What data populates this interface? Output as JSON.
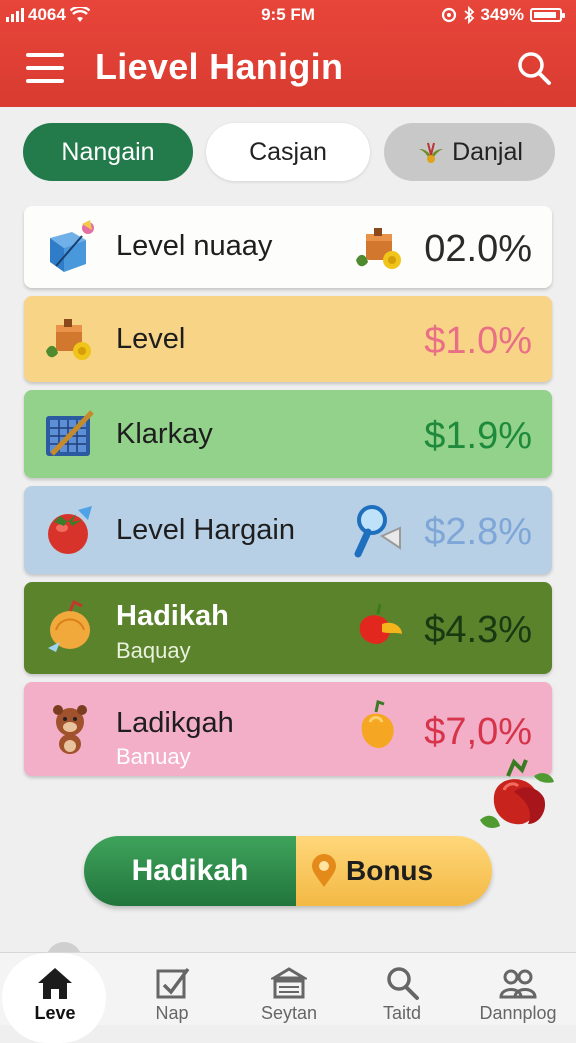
{
  "status_bar": {
    "carrier": "4064",
    "time": "9:5 FM",
    "battery": "349%"
  },
  "header": {
    "title": "Lievel Hanigin"
  },
  "tabs": [
    {
      "label": "Nangain"
    },
    {
      "label": "Casjan"
    },
    {
      "label": "Danjal"
    }
  ],
  "cards": [
    {
      "label": "Level nuaay",
      "value": "02.0%",
      "value_color": "#2a2a2a",
      "icon": "blue-cube-icon",
      "deco": "crate-icon"
    },
    {
      "label": "Level",
      "value": "$1.0%",
      "value_color": "#e96f86",
      "icon": "crate-icon"
    },
    {
      "label": "Klarkay",
      "value": "$1.9%",
      "value_color": "#1f8a3c",
      "icon": "grid-tablet-icon"
    },
    {
      "label": "Level Hargain",
      "value": "$2.8%",
      "value_color": "#7ea7d8",
      "icon": "tomato-icon",
      "deco": "magnifier-icon"
    },
    {
      "label": "Hadikah",
      "sub": "Baquay",
      "value": "$4.3%",
      "value_color": "#183a12",
      "icon": "onion-icon",
      "deco": "pepper-icon"
    },
    {
      "label": "Ladikgah",
      "sub": "Banuay",
      "value": "$7,0%",
      "value_color": "#d6344a",
      "icon": "bear-icon",
      "deco": "yellow-pepper-icon"
    }
  ],
  "bonus_button": {
    "left_label": "Hadikah",
    "right_label": "Bonus"
  },
  "bottom_nav": [
    {
      "label": "Leve",
      "icon": "home-icon",
      "active": true
    },
    {
      "label": "Nap",
      "icon": "checkbox-icon"
    },
    {
      "label": "Seytan",
      "icon": "bank-icon"
    },
    {
      "label": "Taitd",
      "icon": "search-icon"
    },
    {
      "label": "Dannplog",
      "icon": "people-icon"
    }
  ]
}
